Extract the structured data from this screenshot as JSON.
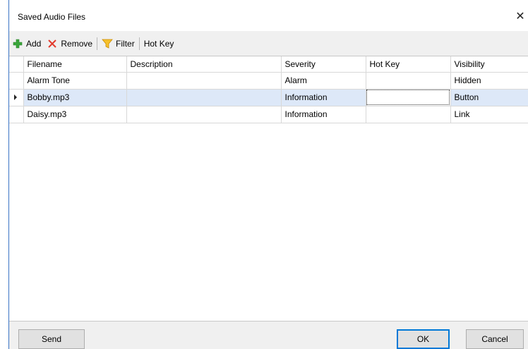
{
  "window": {
    "title": "Saved Audio Files",
    "close_glyph": "✕"
  },
  "toolbar": {
    "add_label": "Add",
    "remove_label": "Remove",
    "filter_label": "Filter",
    "hotkey_label": "Hot Key",
    "icons": {
      "add": "plus-icon",
      "remove": "x-icon",
      "filter": "funnel-icon"
    },
    "colors": {
      "add": "#3aa53a",
      "remove": "#e23b2e",
      "filter": "#f2b000"
    }
  },
  "grid": {
    "columns": [
      "Filename",
      "Description",
      "Severity",
      "Hot Key",
      "Visibility"
    ],
    "rows": [
      {
        "filename": "Alarm Tone",
        "description": "",
        "severity": "Alarm",
        "hotkey": "",
        "visibility": "Hidden"
      },
      {
        "filename": "Bobby.mp3",
        "description": "",
        "severity": "Information",
        "hotkey": "",
        "visibility": "Button"
      },
      {
        "filename": "Daisy.mp3",
        "description": "",
        "severity": "Information",
        "hotkey": "",
        "visibility": "Link"
      }
    ],
    "selected_row": 1,
    "colors": {
      "selected_row": "#dde8f8"
    }
  },
  "footer": {
    "send_label": "Send",
    "ok_label": "OK",
    "cancel_label": "Cancel"
  }
}
